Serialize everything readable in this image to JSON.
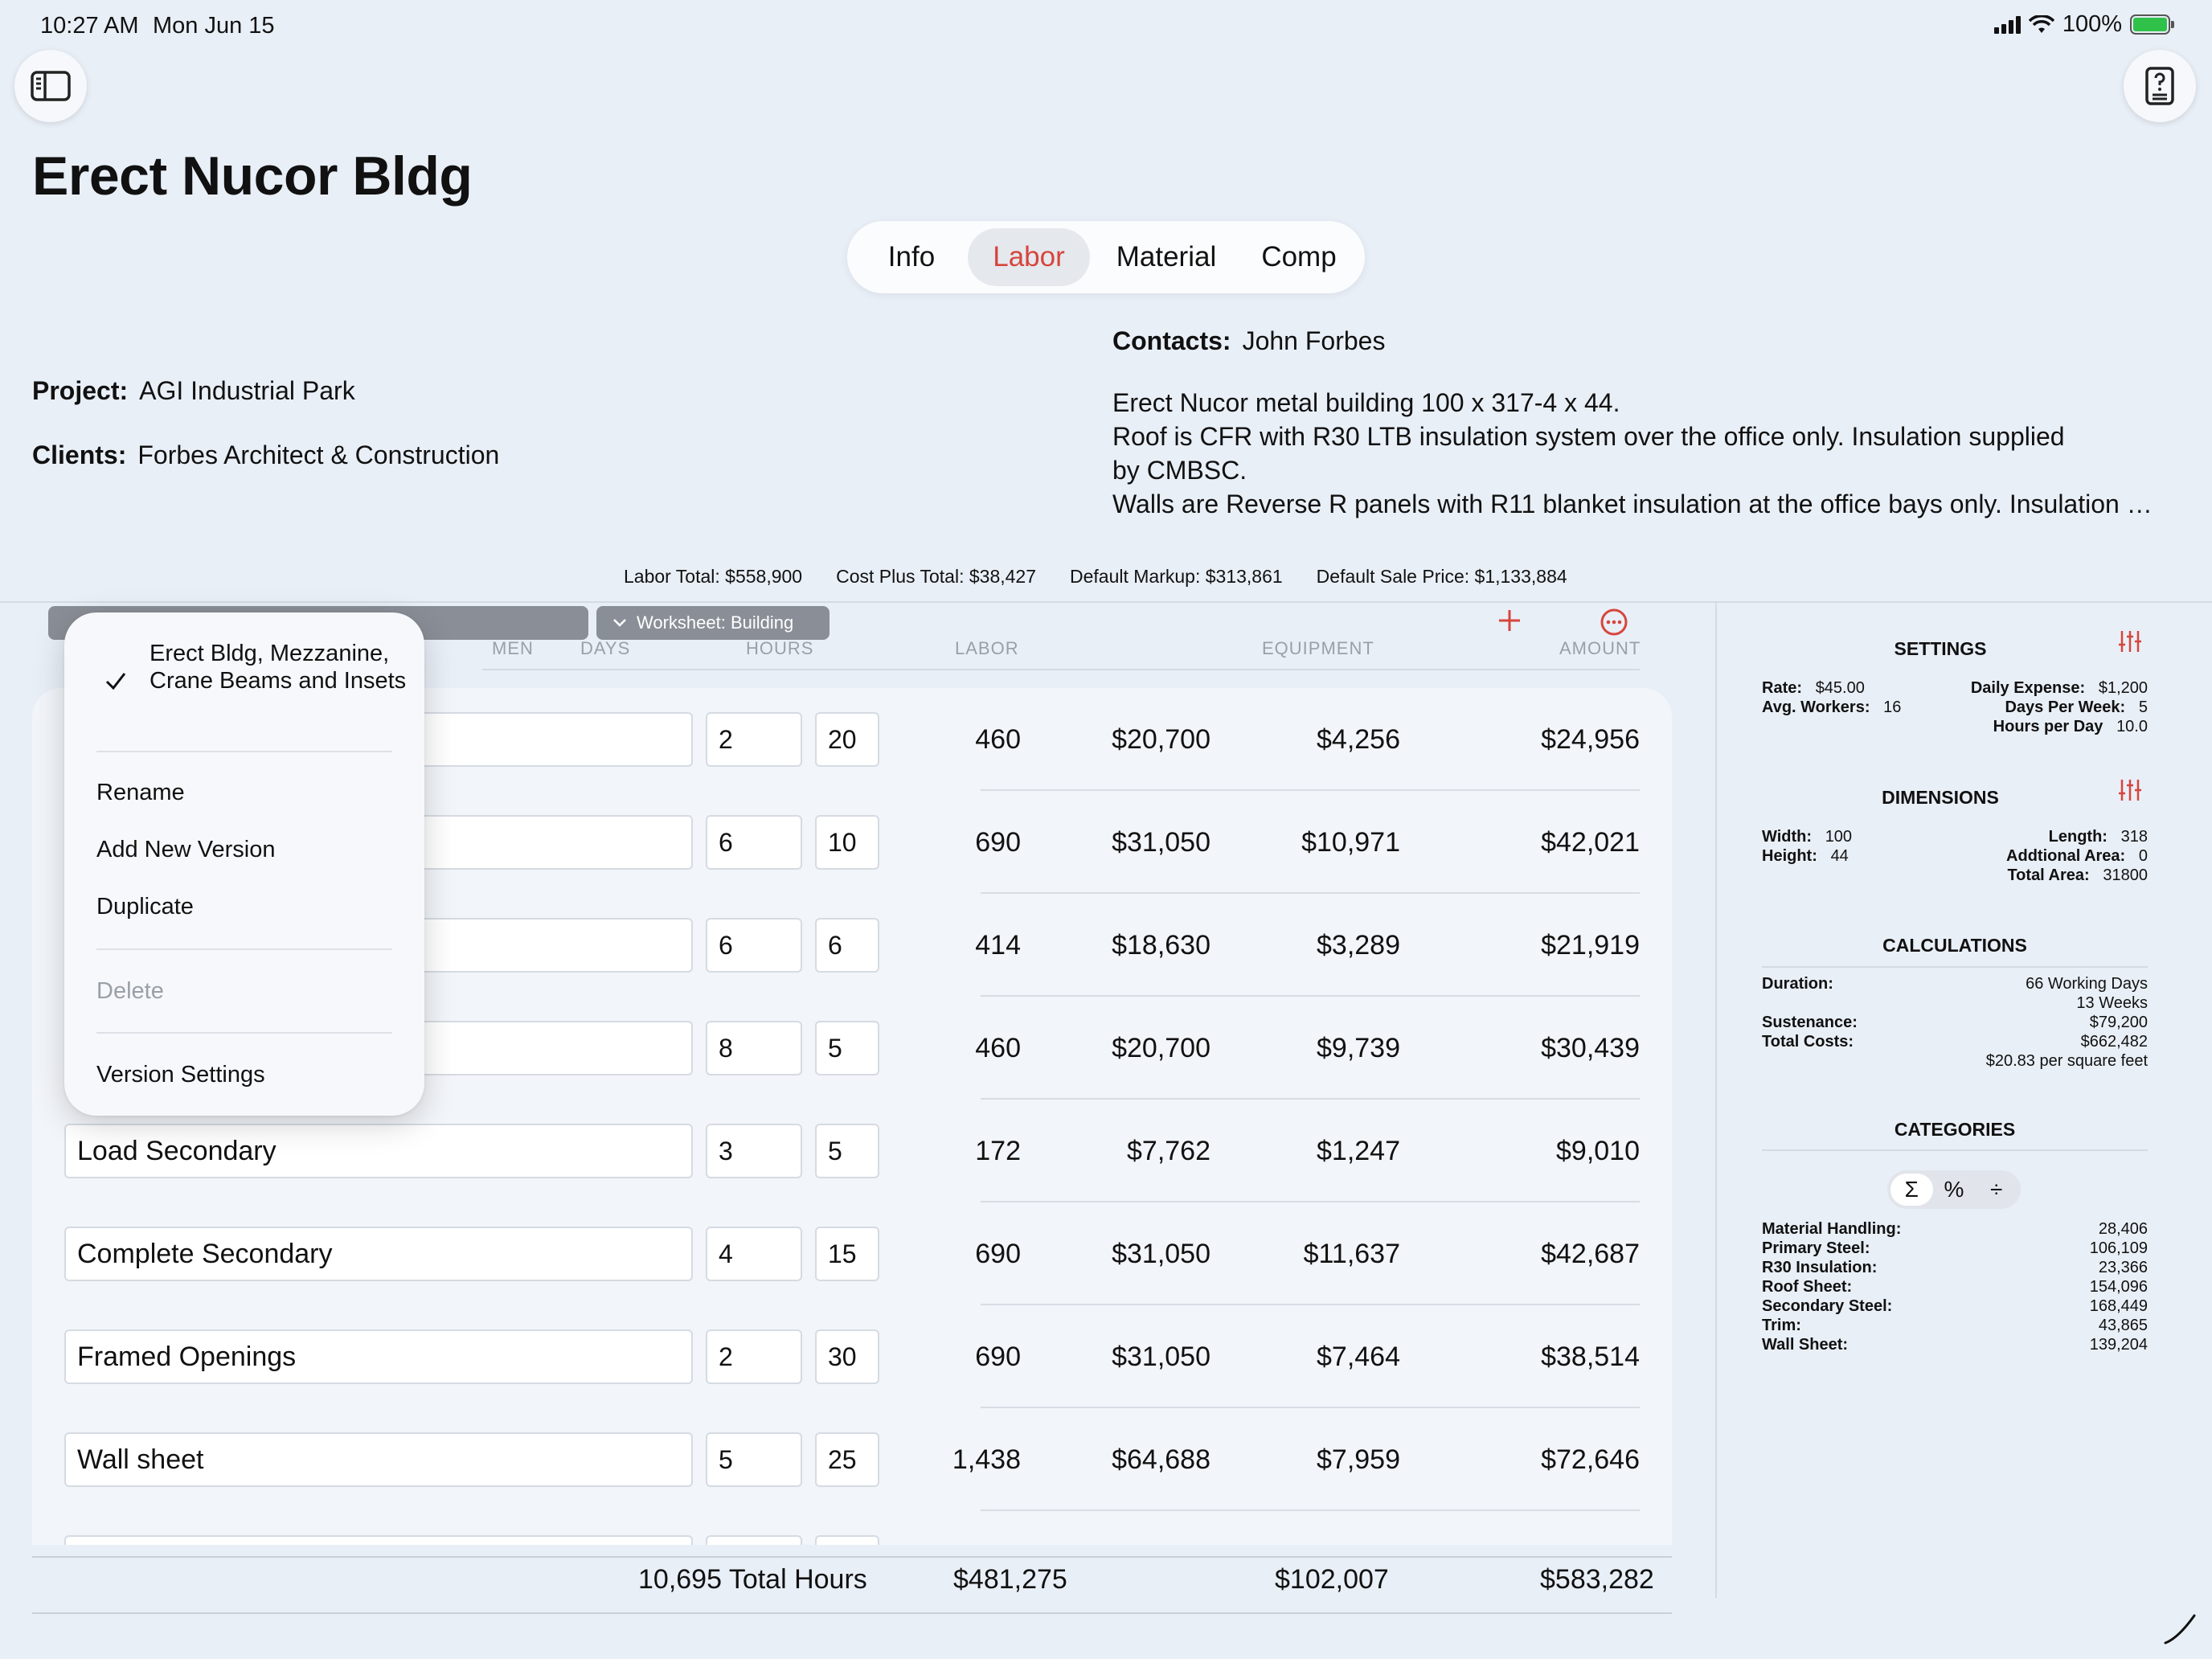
{
  "status": {
    "time": "10:27 AM",
    "date": "Mon Jun 15",
    "battery": "100%"
  },
  "title": "Erect Nucor Bldg",
  "tabs": [
    {
      "label": "Info",
      "active": false
    },
    {
      "label": "Labor",
      "active": true
    },
    {
      "label": "Material",
      "active": false
    },
    {
      "label": "Comp",
      "active": false
    }
  ],
  "fields": {
    "project_label": "Project:",
    "project_value": "AGI Industrial Park",
    "clients_label": "Clients:",
    "clients_value": "Forbes Architect & Construction",
    "contacts_label": "Contacts:",
    "contacts_value": "John  Forbes"
  },
  "description": [
    "Erect Nucor metal building 100 x 317-4 x 44.",
    "Roof is CFR with R30 LTB insulation system over the office only. Insulation supplied",
    "by CMBSC.",
    "Walls are Reverse R panels with R11 blanket insulation at the office bays only. Insulation supplied by CMBSC."
  ],
  "totals": {
    "labor_total": "Labor Total: $558,900",
    "cost_plus_total": "Cost Plus Total: $38,427",
    "default_markup": "Default Markup: $313,861",
    "default_sale_price": "Default Sale Price: $1,133,884"
  },
  "worksheet": {
    "label": "Worksheet: Building"
  },
  "columns": {
    "men": "MEN",
    "days": "DAYS",
    "hours": "HOURS",
    "labor": "LABOR",
    "equipment": "EQUIPMENT",
    "amount": "AMOUNT"
  },
  "rows": [
    {
      "name": "",
      "men": "2",
      "days": "20",
      "hours": "460",
      "labor": "$20,700",
      "equipment": "$4,256",
      "amount": "$24,956"
    },
    {
      "name": "",
      "men": "6",
      "days": "10",
      "hours": "690",
      "labor": "$31,050",
      "equipment": "$10,971",
      "amount": "$42,021"
    },
    {
      "name": "",
      "men": "6",
      "days": "6",
      "hours": "414",
      "labor": "$18,630",
      "equipment": "$3,289",
      "amount": "$21,919"
    },
    {
      "name": "",
      "men": "8",
      "days": "5",
      "hours": "460",
      "labor": "$20,700",
      "equipment": "$9,739",
      "amount": "$30,439"
    },
    {
      "name": "Load Secondary",
      "men": "3",
      "days": "5",
      "hours": "172",
      "labor": "$7,762",
      "equipment": "$1,247",
      "amount": "$9,010"
    },
    {
      "name": "Complete Secondary",
      "men": "4",
      "days": "15",
      "hours": "690",
      "labor": "$31,050",
      "equipment": "$11,637",
      "amount": "$42,687"
    },
    {
      "name": "Framed Openings",
      "men": "2",
      "days": "30",
      "hours": "690",
      "labor": "$31,050",
      "equipment": "$7,464",
      "amount": "$38,514"
    },
    {
      "name": "Wall sheet",
      "men": "5",
      "days": "25",
      "hours": "1,438",
      "labor": "$64,688",
      "equipment": "$7,959",
      "amount": "$72,646"
    }
  ],
  "footer": {
    "total_hours": "10,695 Total Hours",
    "labor": "$481,275",
    "equipment": "$102,007",
    "amount": "$583,282"
  },
  "menu": {
    "current_version": "Erect Bldg, Mezzanine, Crane Beams and Insets",
    "rename": "Rename",
    "add_new_version": "Add New Version",
    "duplicate": "Duplicate",
    "delete": "Delete",
    "version_settings": "Version Settings"
  },
  "settings": {
    "heading": "SETTINGS",
    "rate_label": "Rate:",
    "rate": "$45.00",
    "avg_workers_label": "Avg. Workers:",
    "avg_workers": "16",
    "daily_expense_label": "Daily Expense:",
    "daily_expense": "$1,200",
    "days_per_week_label": "Days Per Week:",
    "days_per_week": "5",
    "hours_per_day_label": "Hours per Day",
    "hours_per_day": "10.0"
  },
  "dimensions": {
    "heading": "DIMENSIONS",
    "width_label": "Width:",
    "width": "100",
    "height_label": "Height:",
    "height": "44",
    "length_label": "Length:",
    "length": "318",
    "additional_area_label": "Addtional Area:",
    "additional_area": "0",
    "total_area_label": "Total Area:",
    "total_area": "31800"
  },
  "calculations": {
    "heading": "CALCULATIONS",
    "duration_label": "Duration:",
    "duration_days": "66 Working Days",
    "duration_weeks": "13 Weeks",
    "sustenance_label": "Sustenance:",
    "sustenance": "$79,200",
    "total_costs_label": "Total Costs:",
    "total_costs": "$662,482",
    "per_sqft": "$20.83 per square feet"
  },
  "categories": {
    "heading": "CATEGORIES",
    "modes": [
      "Σ",
      "%",
      "÷"
    ],
    "items": [
      {
        "label": "Material Handling:",
        "value": "28,406"
      },
      {
        "label": "Primary Steel:",
        "value": "106,109"
      },
      {
        "label": "R30 Insulation:",
        "value": "23,366"
      },
      {
        "label": "Roof Sheet:",
        "value": "154,096"
      },
      {
        "label": "Secondary Steel:",
        "value": "168,449"
      },
      {
        "label": "Trim:",
        "value": "43,865"
      },
      {
        "label": "Wall Sheet:",
        "value": "139,204"
      }
    ]
  },
  "colors": {
    "accent": "#d6453c",
    "background": "#e9eff7"
  },
  "icons": {
    "sidebar": "sidebar-toggle-icon",
    "inspector": "document-help-icon",
    "add": "plus-icon",
    "more": "ellipsis-circle-icon",
    "adjust": "sliders-icon"
  }
}
